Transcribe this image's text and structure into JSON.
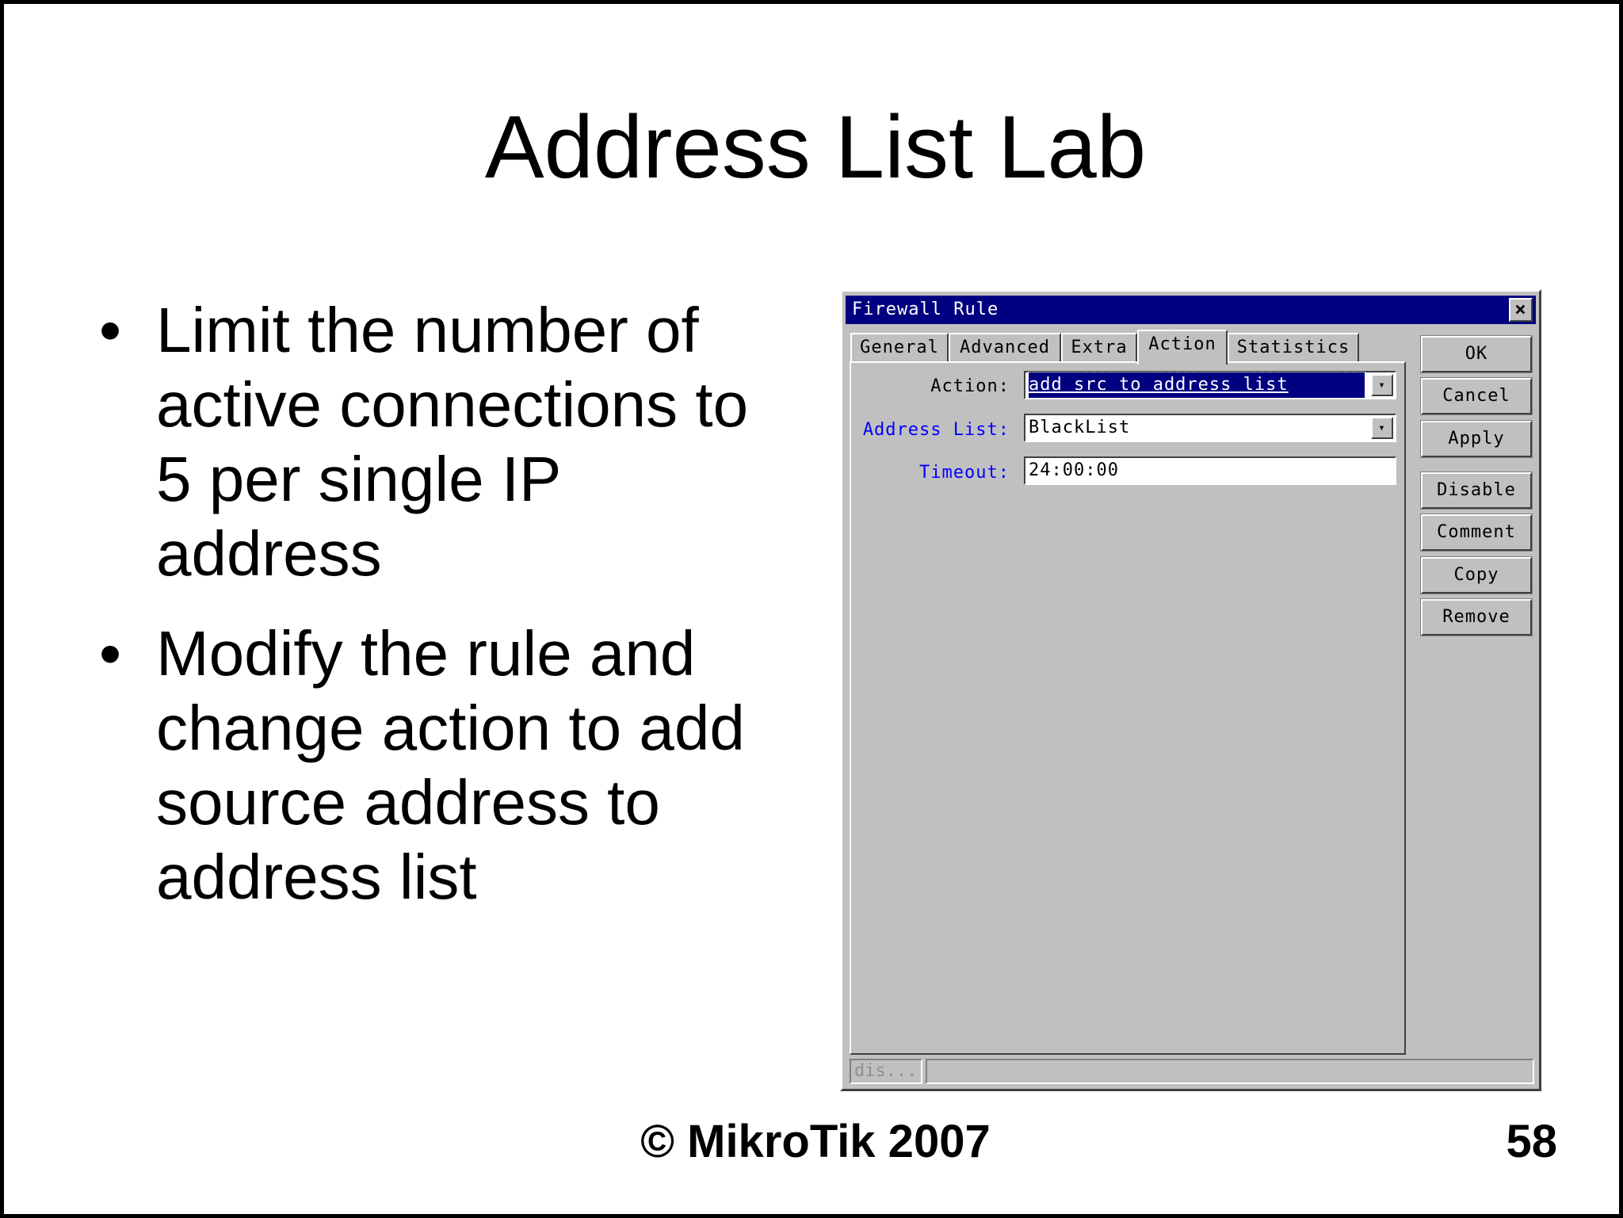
{
  "slide": {
    "title": "Address List Lab",
    "bullets": [
      "Limit the number of active connections to 5 per single IP address",
      "Modify the rule and change action to add source address to address list"
    ],
    "bullet_symbol": "•",
    "copyright": "© MikroTik 2007",
    "page_number": "58"
  },
  "dialog": {
    "title": "Firewall Rule",
    "close_symbol": "×",
    "tabs": [
      "General",
      "Advanced",
      "Extra",
      "Action",
      "Statistics"
    ],
    "active_tab": "Action",
    "fields": {
      "action_label": "Action:",
      "action_value": "add src to address list",
      "address_list_label": "Address List:",
      "address_list_value": "BlackList",
      "timeout_label": "Timeout:",
      "timeout_value": "24:00:00"
    },
    "dropdown_symbol": "▾",
    "buttons": {
      "ok": "OK",
      "cancel": "Cancel",
      "apply": "Apply",
      "disable": "Disable",
      "comment": "Comment",
      "copy": "Copy",
      "remove": "Remove"
    },
    "status_text": "dis..."
  },
  "colors": {
    "titlebar": "#000080",
    "dialog_bg": "#c0c0c0",
    "blue_label": "#0000ff"
  }
}
